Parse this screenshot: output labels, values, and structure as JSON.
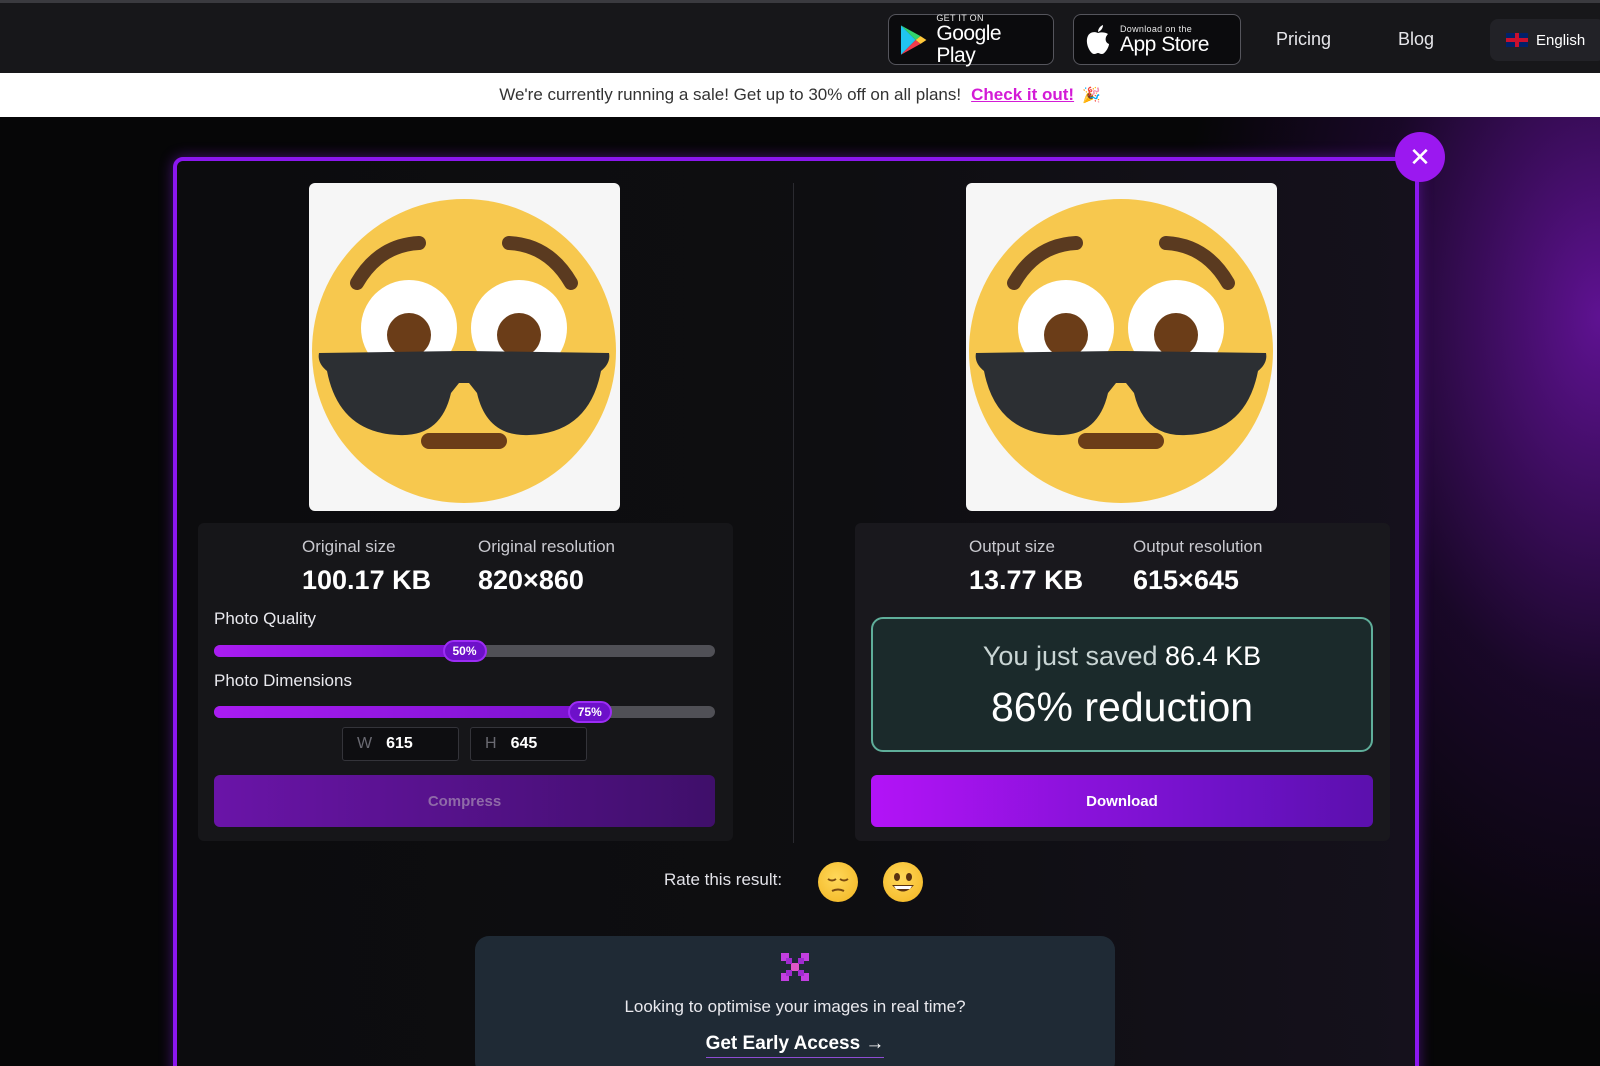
{
  "nav": {
    "google_play": {
      "small": "GET IT ON",
      "big": "Google Play"
    },
    "app_store": {
      "small": "Download on the",
      "big": "App Store"
    },
    "pricing": "Pricing",
    "blog": "Blog",
    "language": "English"
  },
  "banner": {
    "text": "We're currently running a sale! Get up to 30% off on all plans!",
    "link": "Check it out!",
    "emoji": "🎉"
  },
  "original": {
    "size_label": "Original size",
    "size_value": "100.17 KB",
    "res_label": "Original resolution",
    "res_value": "820×860"
  },
  "controls": {
    "quality_label": "Photo Quality",
    "quality_value": "50%",
    "quality_fraction": 0.5,
    "dimensions_label": "Photo Dimensions",
    "dimensions_value": "75%",
    "dimensions_fraction": 0.75,
    "width_prefix": "W",
    "width_value": "615",
    "height_prefix": "H",
    "height_value": "645",
    "compress_label": "Compress"
  },
  "output": {
    "size_label": "Output size",
    "size_value": "13.77 KB",
    "res_label": "Output resolution",
    "res_value": "615×645",
    "saved_prefix": "You just saved",
    "saved_amount": "86.4 KB",
    "reduction": "86% reduction",
    "download_label": "Download"
  },
  "rating": {
    "label": "Rate this result:"
  },
  "promo": {
    "question": "Looking to optimise your images in real time?",
    "cta": "Get Early Access →"
  },
  "colors": {
    "accent": "#9b18f0",
    "saved_border": "#5fae9a"
  }
}
